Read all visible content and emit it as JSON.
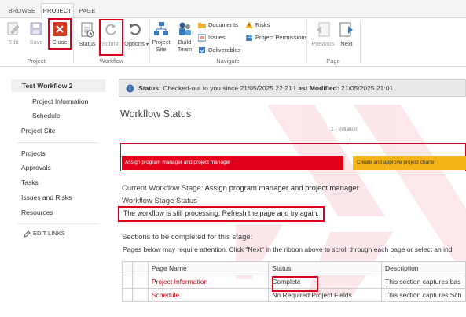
{
  "tabs": [
    "BROWSE",
    "PROJECT",
    "PAGE"
  ],
  "ribbon": {
    "edit": "Edit",
    "save": "Save",
    "close": "Close",
    "status": "Status",
    "submit": "Submit",
    "options": "Options",
    "project_site": [
      "Project",
      "Site"
    ],
    "build_team": [
      "Build",
      "Team"
    ],
    "documents": "Documents",
    "issues": "Issues",
    "deliverables": "Deliverables",
    "risks": "Risks",
    "project_permissions": "Project Permissions",
    "previous": "Previous",
    "next": "Next",
    "groups": {
      "project": "Project",
      "workflow": "Workflow",
      "navigate": "Navigate",
      "page": "Page"
    }
  },
  "nav": {
    "title": "Test Workflow 2",
    "sub_items": [
      "Project Information",
      "Schedule"
    ],
    "project_site": "Project Site",
    "items": [
      "Projects",
      "Approvals",
      "Tasks",
      "Issues and Risks",
      "Resources"
    ],
    "edit_links": "EDIT LINKS"
  },
  "status": {
    "label": "Status:",
    "text": "Checked-out to you since 21/05/2025 22:21",
    "modified_label": "Last Modified:",
    "modified": "21/05/2025 21:01"
  },
  "main": {
    "title": "Workflow Status",
    "stage_label": "1 - Initiation",
    "bar_red": "Assign program manager and project manager",
    "bar_yellow": "Create and approve project charter",
    "current_label": "Current Workflow Stage:",
    "current_value": "Assign program manager and project manager",
    "stage_status_label": "Workflow Stage Status",
    "processing": "The workflow is still processing. Refresh the page and try again.",
    "sections_heading": "Sections to be completed for this stage:",
    "note": "Pages below may require attention. Click \"Next\" in the ribbon above to scroll through each page or select an ind"
  },
  "table": {
    "headers": [
      "Page Name",
      "Status",
      "Description"
    ],
    "rows": [
      {
        "name": "Project Information",
        "status": "Complete",
        "desc": "This section captures bas"
      },
      {
        "name": "Schedule",
        "status": "No Required Project Fields",
        "desc": "This section captures Sch"
      }
    ]
  },
  "colors": {
    "accent_red": "#d9001b",
    "stage_red": "#e2001a",
    "stage_yellow": "#f6b418",
    "link_red": "#c8000f"
  }
}
